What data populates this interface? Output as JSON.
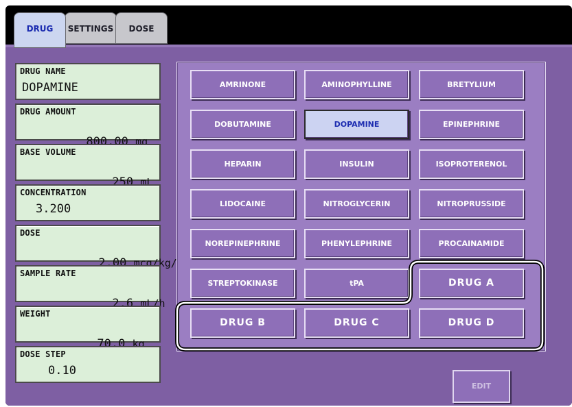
{
  "tabs": [
    {
      "label": "DRUG",
      "active": true
    },
    {
      "label": "SETTINGS",
      "active": false
    },
    {
      "label": "DOSE",
      "active": false
    }
  ],
  "info": {
    "drug_name": {
      "label": "DRUG NAME",
      "value": "DOPAMINE"
    },
    "drug_amount": {
      "label": "DRUG AMOUNT",
      "value": "800.00",
      "unit": "mg"
    },
    "base_volume": {
      "label": "BASE VOLUME",
      "value": "250",
      "unit": "mL"
    },
    "concentration": {
      "label": "CONCENTRATION",
      "value": "3.200"
    },
    "dose": {
      "label": "DOSE",
      "value": "2.00",
      "unit": "mcg/kg/min"
    },
    "sample_rate": {
      "label": "SAMPLE RATE",
      "value": "2.6",
      "unit": "mL/h"
    },
    "weight": {
      "label": "WEIGHT",
      "value": "70.0",
      "unit": "kg"
    },
    "dose_step": {
      "label": "DOSE STEP",
      "value": "0.10"
    }
  },
  "drugs": [
    "AMRINONE",
    "AMINOPHYLLINE",
    "BRETYLIUM",
    "DOBUTAMINE",
    "DOPAMINE",
    "EPINEPHRINE",
    "HEPARIN",
    "INSULIN",
    "ISOPROTERENOL",
    "LIDOCAINE",
    "NITROGLYCERIN",
    "NITROPRUSSIDE",
    "NOREPINEPHRINE",
    "PHENYLEPHRINE",
    "PROCAINAMIDE",
    "STREPTOKINASE",
    "tPA",
    "DRUG A",
    "DRUG B",
    "DRUG C",
    "DRUG D"
  ],
  "selected_drug": "DOPAMINE",
  "edit_label": "EDIT",
  "colors": {
    "panel": "#7e5fa3",
    "button": "#8e6fb8",
    "selected_button": "#ccd3f2",
    "info_box": "#dcefd9"
  }
}
